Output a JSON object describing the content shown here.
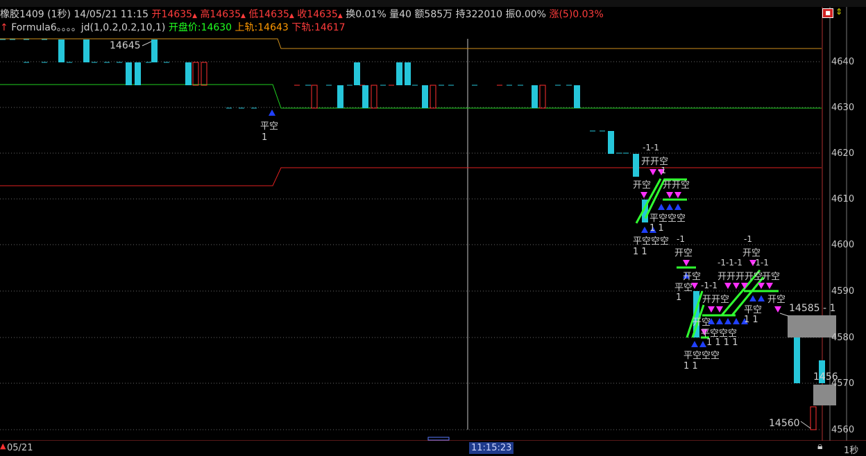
{
  "header": {
    "symbol": "橡胶1409 (1秒)",
    "datetime": "14/05/21 11:15",
    "open_label": "开14635",
    "high_label": "高14635",
    "low_label": "低14635",
    "close_label": "收14635",
    "turnover": "换0.01%",
    "volume": "量40",
    "amount": "额585万",
    "hold": "持322010",
    "amplitude": "振0.00%",
    "change": "涨(5)0.03%"
  },
  "formula": {
    "name": "Formula6。。。。jd(1,0.2,0.2,10,1)",
    "open_price": "开盘价:14630",
    "upper": "上轨:14643",
    "lower": "下轨:14617"
  },
  "price_axis": [
    "4640",
    "4630",
    "4620",
    "4610",
    "4600",
    "4590",
    "4580",
    "4570",
    "4560"
  ],
  "annotations": {
    "high_marker": "14645",
    "last_marker": "14585 - 1",
    "low_marker": "14560",
    "partial_marker": "1456"
  },
  "signals": {
    "close_short": "平空",
    "open_short": "开空",
    "one": "1",
    "one_one": "1 1",
    "four_ones": "1 1 1 1",
    "minus_one": "-1",
    "minus_one_one": "-1-1",
    "minus_one_one_one": "-1-1-1",
    "repeated_ping": "平空空空",
    "repeated_kai": "开开空",
    "repeated_kai2": "开开开开空"
  },
  "footer": {
    "date": "05/21",
    "crosshair_time": "11:15:23",
    "period": "1秒"
  },
  "colors": {
    "up_bar": "#26c6da",
    "down_bar": "#ff3030",
    "upper_band": "#d0901c",
    "mid_band": "#20d020",
    "lower_band": "#e02020",
    "signal_green": "#30ff30"
  }
}
